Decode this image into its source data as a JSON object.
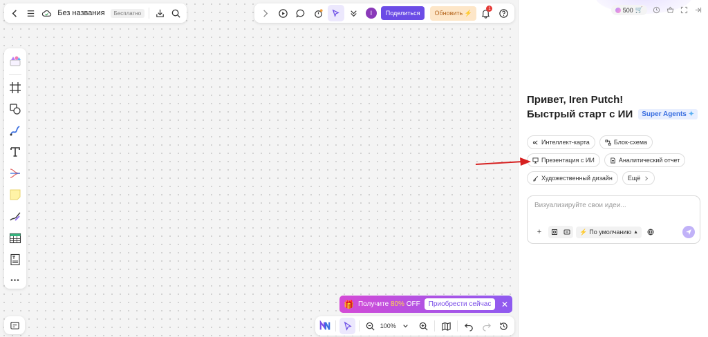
{
  "toolbar_left": {
    "doc_title": "Без названия",
    "plan_badge": "Бесплатно"
  },
  "toolbar_mid": {
    "avatar_initial": "I",
    "share_label": "Поделиться",
    "upgrade_label": "Обновить",
    "notification_count": "1"
  },
  "promo": {
    "text_prefix": "Получите",
    "discount": "80%",
    "text_suffix": "OFF",
    "cta_label": "Приобрести сейчас",
    "close": "✕"
  },
  "bottom_bar": {
    "zoom": "100%"
  },
  "panel": {
    "credits": "500",
    "greeting": "Привет, Iren Putch!",
    "subtitle": "Быстрый старт с ИИ",
    "badge": "Super Agents",
    "chips_row1": [
      "Интеллект-карта",
      "Блок-схема"
    ],
    "chips_row2": [
      "Презентация с ИИ",
      "Аналитический отчет"
    ],
    "chips_row3": [
      "Художественный дизайн",
      "Ещё"
    ],
    "prompt_placeholder": "Визуализируйте свои идеи...",
    "mode_label": "По умолчанию"
  },
  "colors": {
    "accent": "#6b4ce6",
    "annotation": "#d62020",
    "promo_start": "#d44ad6",
    "promo_end": "#8e5bf0"
  }
}
